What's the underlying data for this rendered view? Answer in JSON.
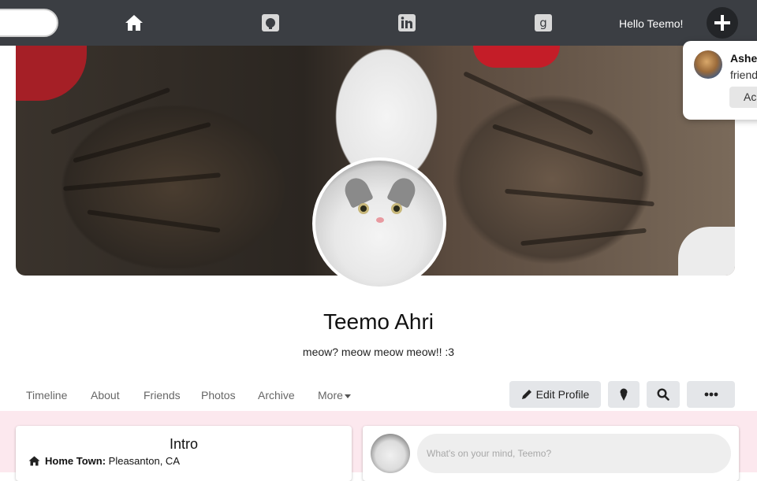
{
  "nav": {
    "greeting": "Hello Teemo!",
    "icons": [
      "home-icon",
      "github-icon",
      "linkedin-icon",
      "goodreads-icon",
      "plus-icon"
    ]
  },
  "notification": {
    "name": "Ashe",
    "text": "friend",
    "button_label": "Ac"
  },
  "profile": {
    "name": "Teemo Ahri",
    "bio": "meow? meow meow meow!! :3"
  },
  "tabs": [
    {
      "label": "Timeline"
    },
    {
      "label": "About"
    },
    {
      "label": "Friends"
    },
    {
      "label": "Photos"
    },
    {
      "label": "Archive"
    },
    {
      "label": "More"
    }
  ],
  "actions": {
    "edit_label": "Edit Profile"
  },
  "intro": {
    "title": "Intro",
    "hometown_label": "Home Town:",
    "hometown_value": "Pleasanton, CA"
  },
  "post": {
    "placeholder": "What's on your mind, Teemo?"
  },
  "colors": {
    "topbar": "#3b3e43",
    "lower_bg": "#fce8ee",
    "button_bg": "#e4e6e9"
  }
}
